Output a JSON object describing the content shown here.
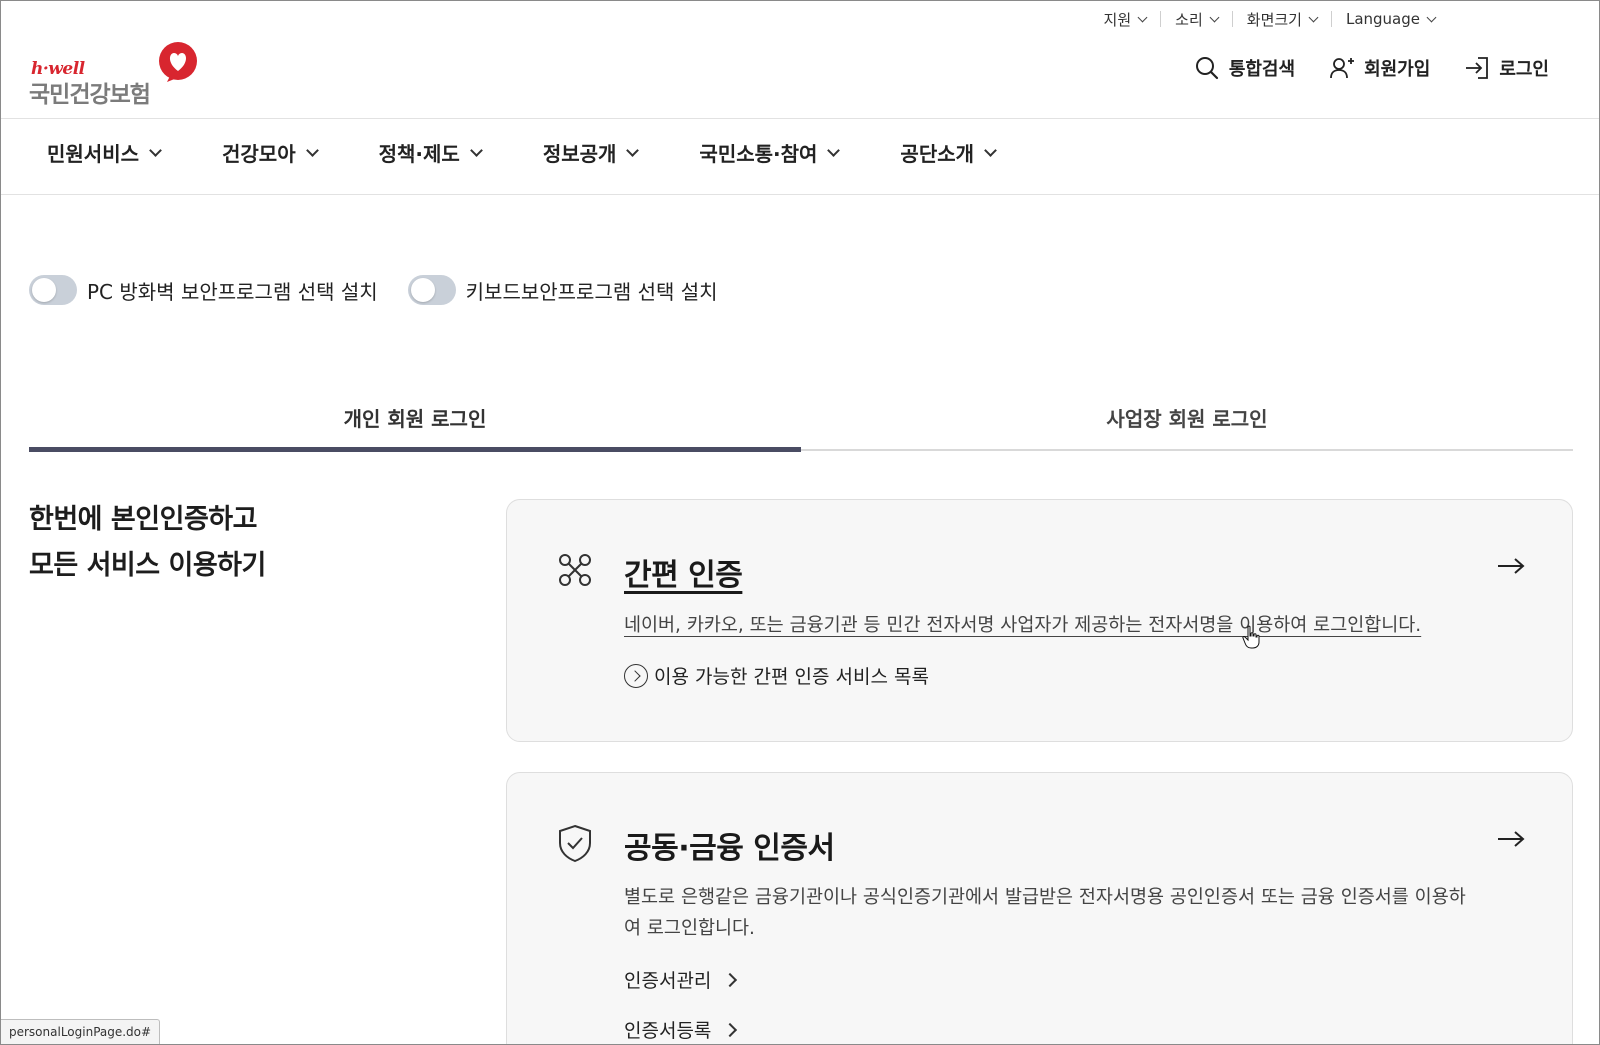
{
  "utility": {
    "items": [
      {
        "label": "지원"
      },
      {
        "label": "소리"
      },
      {
        "label": "화면크기"
      },
      {
        "label": "Language"
      }
    ]
  },
  "logo": {
    "sub": "h·well",
    "main": "국민건강보험"
  },
  "header": {
    "search": "통합검색",
    "signup": "회원가입",
    "login": "로그인"
  },
  "gnb": {
    "items": [
      {
        "label": "민원서비스"
      },
      {
        "label": "건강모아"
      },
      {
        "label": "정책·제도"
      },
      {
        "label": "정보공개"
      },
      {
        "label": "국민소통·참여"
      },
      {
        "label": "공단소개"
      }
    ]
  },
  "toggles": {
    "firewall": "PC 방화벽 보안프로그램 선택 설치",
    "keyboard": "키보드보안프로그램 선택 설치"
  },
  "tabs": {
    "personal": "개인 회원 로그인",
    "business": "사업장 회원 로그인"
  },
  "intro": {
    "line1": "한번에 본인인증하고",
    "line2": "모든 서비스 이용하기"
  },
  "simple_auth": {
    "title": "간편 인증",
    "desc": "네이버, 카카오, 또는 금융기관 등 민간 전자서명 사업자가 제공하는 전자서명을 이용하여 로그인합니다.",
    "service_link": "이용 가능한 간편 인증 서비스 목록"
  },
  "cert_auth": {
    "title": "공동·금융 인증서",
    "desc": "별도로 은행같은 금융기관이나 공식인증기관에서 발급받은 전자서명용 공인인증서 또는 금융 인증서를 이용하여 로그인합니다.",
    "manage": "인증서관리",
    "register": "인증서등록"
  },
  "status_bar": {
    "url": "personalLoginPage.do#"
  },
  "colors": {
    "brand_red": "#d8262f",
    "tab_active": "#4a4c63",
    "card_bg": "#f7f7f7"
  }
}
